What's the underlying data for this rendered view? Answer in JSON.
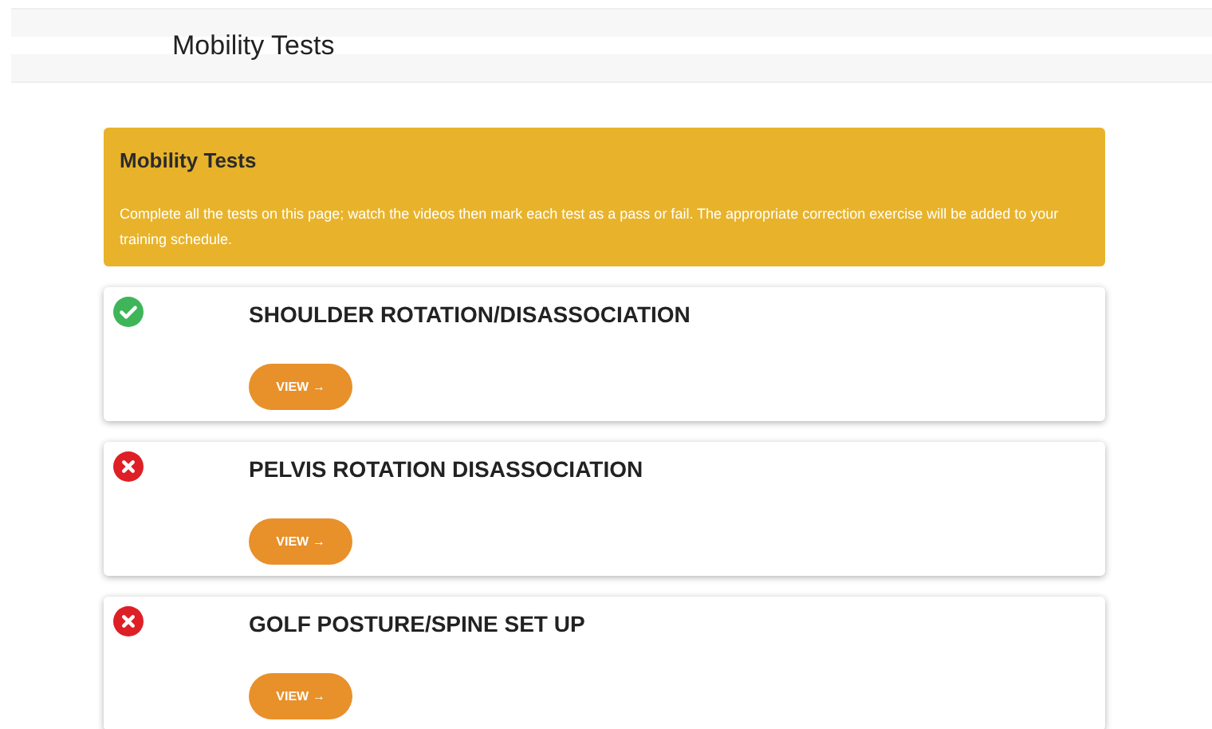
{
  "header": {
    "title": "Mobility Tests"
  },
  "notice": {
    "title": "Mobility Tests",
    "text": "Complete all the tests on this page; watch the videos then mark each test as a pass or fail. The appropriate correction exercise will be added to your training schedule."
  },
  "tests": [
    {
      "name": "SHOULDER ROTATION/DISASSOCIATION",
      "passed": true,
      "button": "VIEW →"
    },
    {
      "name": "PELVIS ROTATION DISASSOCIATION",
      "passed": false,
      "button": "VIEW →"
    },
    {
      "name": "GOLF POSTURE/SPINE SET UP",
      "passed": false,
      "button": "VIEW →"
    }
  ]
}
